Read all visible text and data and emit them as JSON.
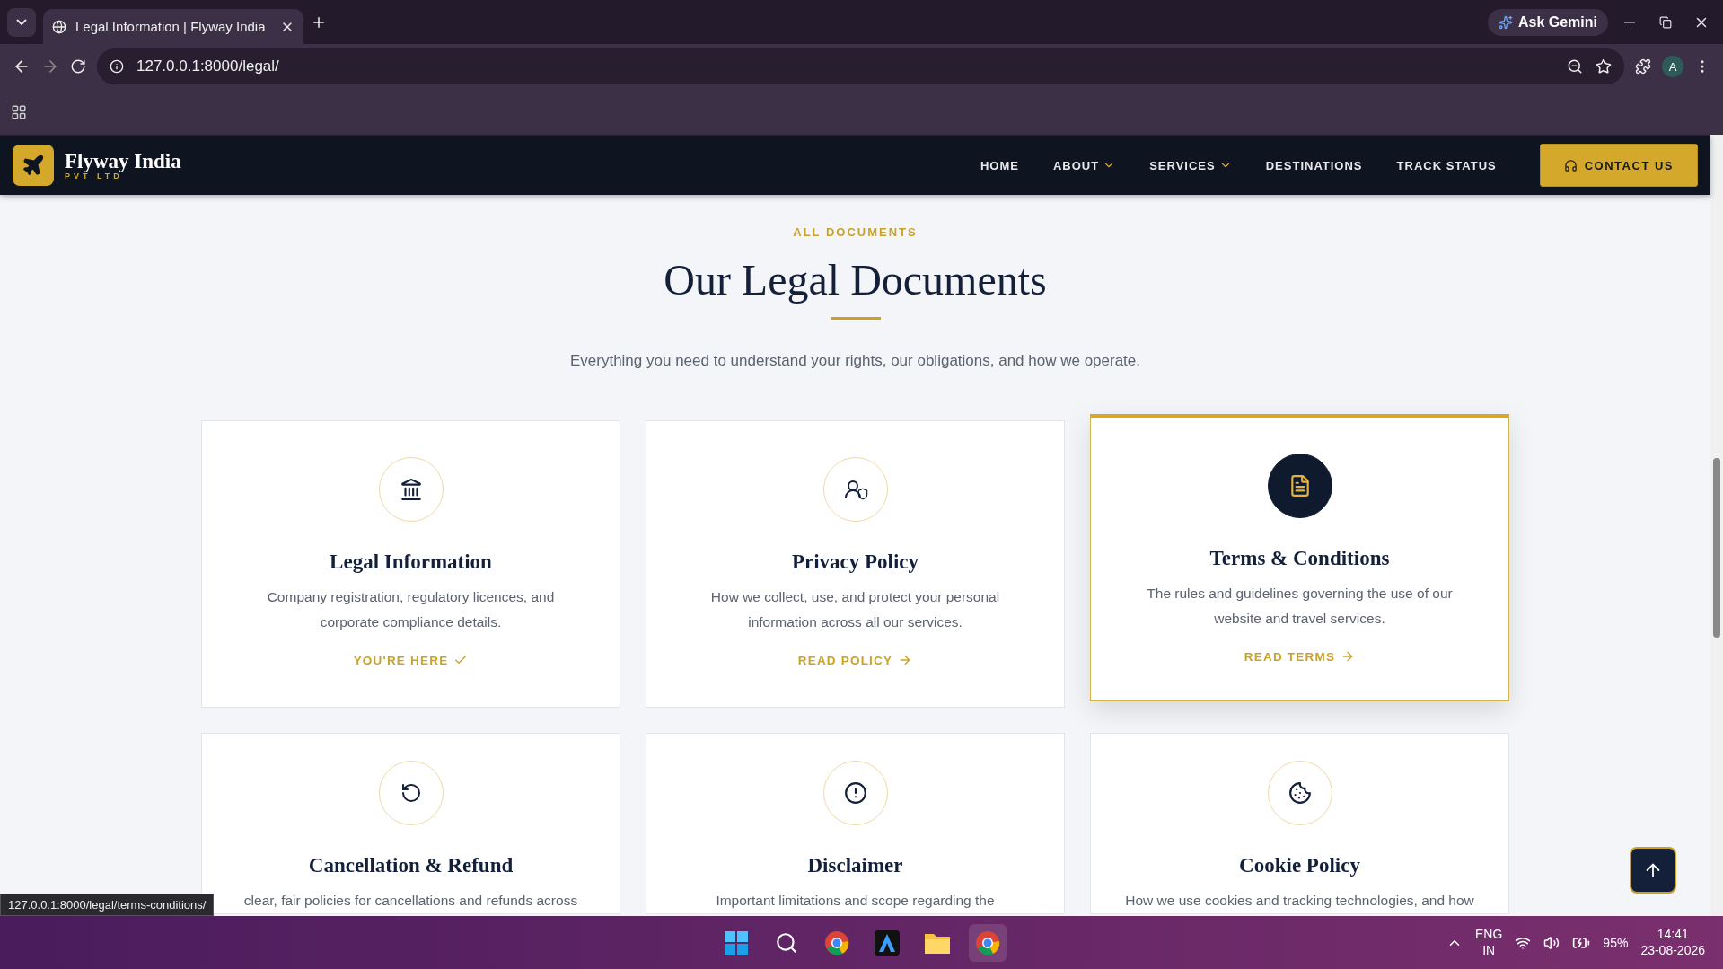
{
  "browser": {
    "tab_title": "Legal Information | Flyway India",
    "url": "127.0.0.1:8000/legal/",
    "assistant_button": "Ask Gemini",
    "profile_initial": "A"
  },
  "navbar": {
    "brand": "Flyway India",
    "brand_sub": "PVT LTD",
    "links": [
      {
        "label": "HOME",
        "dropdown": false
      },
      {
        "label": "ABOUT",
        "dropdown": true
      },
      {
        "label": "SERVICES",
        "dropdown": true
      },
      {
        "label": "DESTINATIONS",
        "dropdown": false
      },
      {
        "label": "TRACK STATUS",
        "dropdown": false
      }
    ],
    "cta": "CONTACT US"
  },
  "section": {
    "eyebrow": "ALL DOCUMENTS",
    "title": "Our Legal Documents",
    "subtitle": "Everything you need to understand your rights, our obligations, and how we operate."
  },
  "cards": [
    {
      "title": "Legal Information",
      "description": "Company registration, regulatory licences, and corporate compliance details.",
      "link": "YOU'RE HERE",
      "current": true,
      "highlighted": false
    },
    {
      "title": "Privacy Policy",
      "description": "How we collect, use, and protect your personal information across all our services.",
      "link": "READ POLICY",
      "current": false,
      "highlighted": false
    },
    {
      "title": "Terms & Conditions",
      "description": "The rules and guidelines governing the use of our website and travel services.",
      "link": "READ TERMS",
      "current": false,
      "highlighted": true
    },
    {
      "title": "Cancellation & Refund",
      "description": "clear, fair policies for cancellations and refunds across",
      "highlighted": false
    },
    {
      "title": "Disclaimer",
      "description": "Important limitations and scope regarding the",
      "highlighted": false
    },
    {
      "title": "Cookie Policy",
      "description": "How we use cookies and tracking technologies, and how",
      "highlighted": false
    }
  ],
  "status_url": "127.0.0.1:8000/legal/terms-conditions/",
  "taskbar": {
    "language": "ENG",
    "region": "IN",
    "battery": "95%",
    "time": "14:41",
    "date": "23-08-2026"
  }
}
